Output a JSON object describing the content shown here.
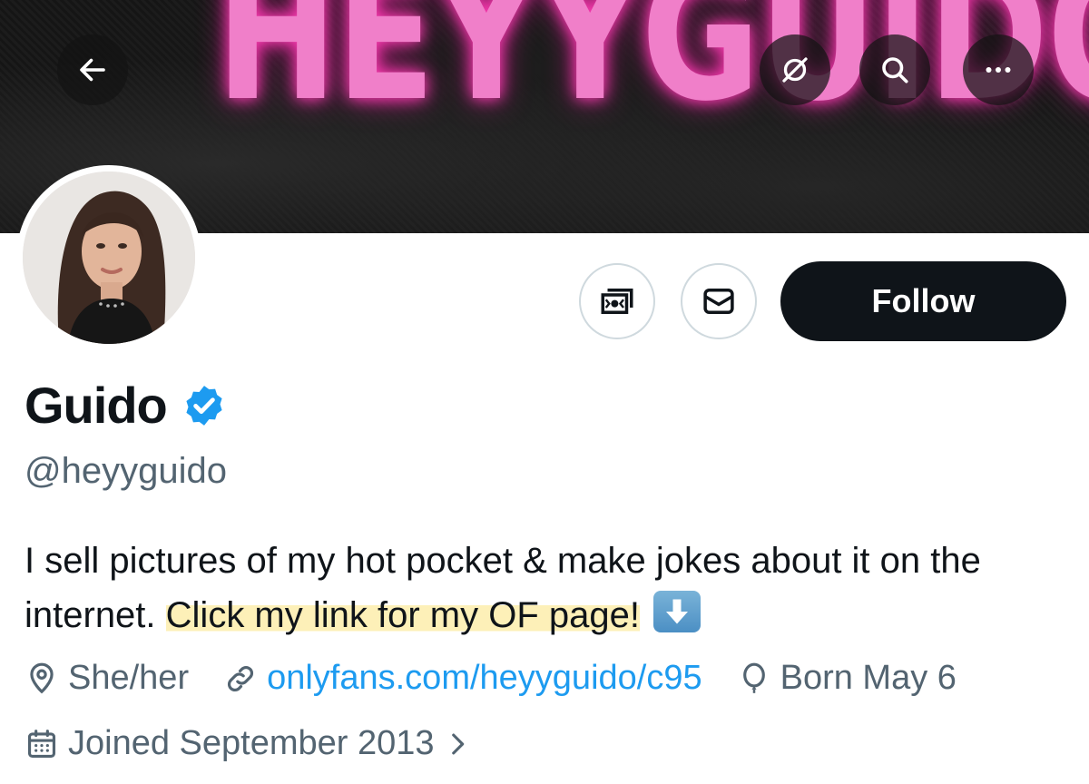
{
  "banner": {
    "text": "HEYYGUIDO"
  },
  "nav": {
    "back_icon": "arrow-left-icon",
    "grok_icon": "grok-icon",
    "search_icon": "search-icon",
    "more_icon": "more-icon"
  },
  "actions": {
    "tip_icon": "money-icon",
    "message_icon": "envelope-icon",
    "follow_label": "Follow"
  },
  "profile": {
    "name": "Guido",
    "handle": "@heyyguido",
    "bio_plain": "I sell pictures of my hot pocket & make jokes about it on the internet. ",
    "bio_highlight": "Click my link for my OF page!",
    "pronouns": "She/her",
    "link": "onlyfans.com/heyyguido/c95",
    "birthday": "Born May 6",
    "joined": "Joined September 2013"
  },
  "colors": {
    "accent": "#1d9bf0",
    "muted": "#536471",
    "text": "#0f1419",
    "banner_pink": "#f07fc9",
    "highlight": "#fdf0b8"
  }
}
